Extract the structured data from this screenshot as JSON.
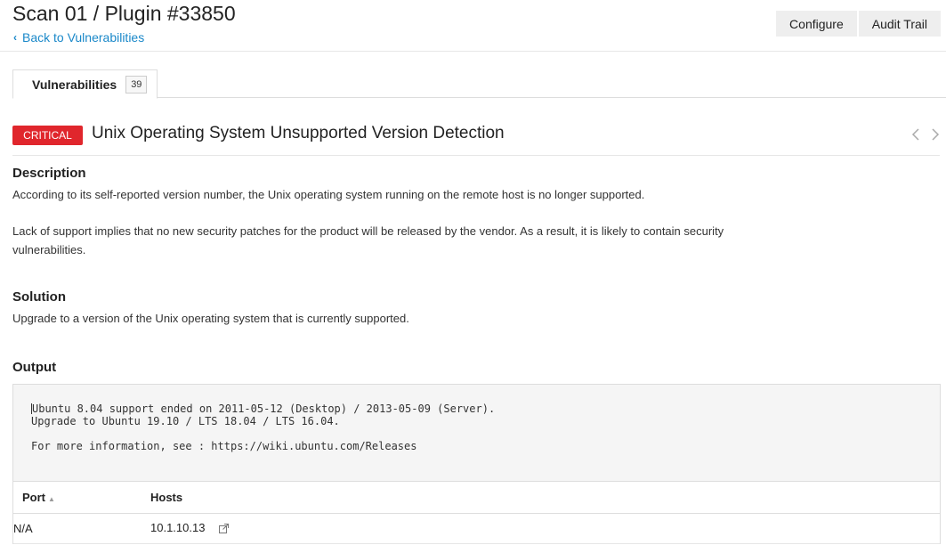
{
  "header": {
    "title": "Scan 01 / Plugin #33850",
    "back_link": "Back to Vulnerabilities",
    "buttons": [
      "Configure",
      "Audit Trail"
    ]
  },
  "tabs": [
    {
      "label": "Vulnerabilities",
      "count": "39"
    }
  ],
  "vulnerability": {
    "severity": "CRITICAL",
    "severity_color": "#e0262c",
    "title": "Unix Operating System Unsupported Version Detection"
  },
  "description": {
    "heading": "Description",
    "paragraphs": [
      "According to its self-reported version number, the Unix operating system running on the remote host is no longer supported.",
      "Lack of support implies that no new security patches for the product will be released by the vendor. As a result, it is likely to contain security vulnerabilities."
    ]
  },
  "solution": {
    "heading": "Solution",
    "text": "Upgrade to a version of the Unix operating system that is currently supported."
  },
  "output": {
    "heading": "Output",
    "lines": [
      "Ubuntu 8.04 support ended on 2011-05-12 (Desktop) / 2013-05-09 (Server).",
      "Upgrade to Ubuntu 19.10 / LTS 18.04 / LTS 16.04.",
      "",
      "For more information, see : https://wiki.ubuntu.com/Releases"
    ],
    "table": {
      "columns": [
        "Port",
        "Hosts"
      ],
      "rows": [
        {
          "port": "N/A",
          "host": "10.1.10.13"
        }
      ]
    }
  },
  "icons": [
    "chevron-left-icon",
    "chevron-left-nav-icon",
    "chevron-right-nav-icon",
    "sort-asc-icon",
    "external-link-icon"
  ]
}
